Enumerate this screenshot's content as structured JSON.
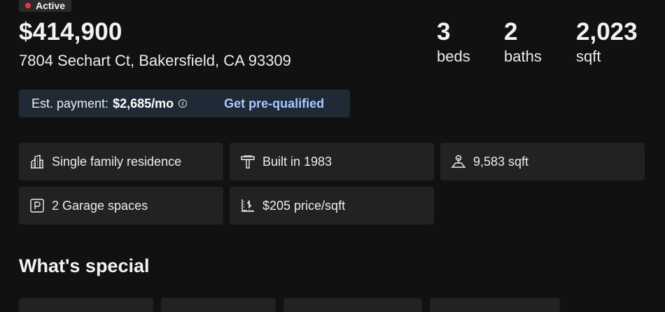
{
  "status": {
    "label": "Active",
    "dot_color": "#e03a3a"
  },
  "listing": {
    "price": "$414,900",
    "address": "7804 Sechart Ct, Bakersfield, CA 93309"
  },
  "stats": {
    "beds": {
      "value": "3",
      "label": "beds"
    },
    "baths": {
      "value": "2",
      "label": "baths"
    },
    "sqft": {
      "value": "2,023",
      "label": "sqft"
    }
  },
  "payment": {
    "label": "Est. payment:",
    "value": "$2,685/mo",
    "info_icon": "info-icon",
    "cta": "Get pre-qualified"
  },
  "facts": [
    {
      "icon": "building-icon",
      "text": "Single family residence"
    },
    {
      "icon": "hammer-icon",
      "text": "Built in 1983"
    },
    {
      "icon": "lot-size-icon",
      "text": "9,583 sqft"
    },
    {
      "icon": "parking-icon",
      "text": "2 Garage spaces"
    },
    {
      "icon": "price-per-sqft-icon",
      "text": "$205 price/sqft"
    }
  ],
  "whats_special": {
    "title": "What's special"
  },
  "colors": {
    "background": "#111112",
    "card": "#222225",
    "payment_bar": "#1f2a36",
    "link": "#a9c9ff"
  }
}
